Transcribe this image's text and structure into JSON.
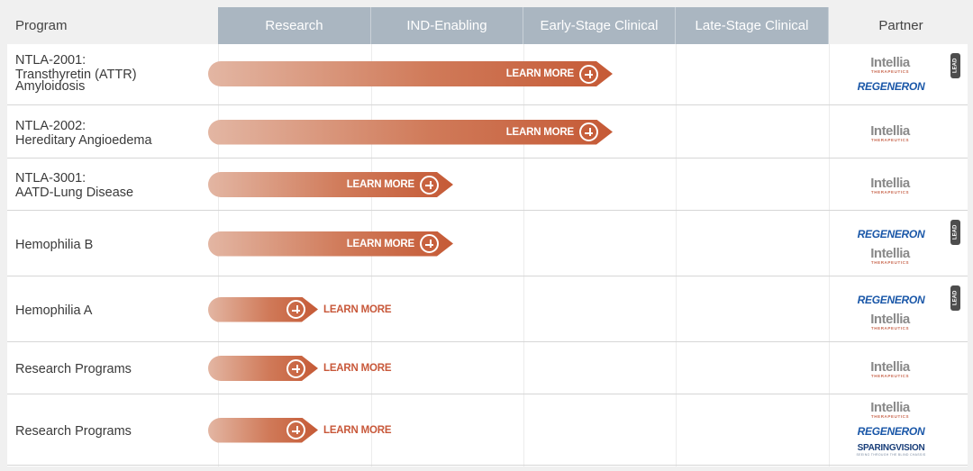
{
  "header": {
    "program": "Program",
    "phases": [
      "Research",
      "IND-Enabling",
      "Early-Stage Clinical",
      "Late-Stage Clinical"
    ],
    "partner": "Partner"
  },
  "bar_label": "LEARN MORE",
  "lead_badge": "LEAD",
  "logos": {
    "intellia": "Intellia",
    "intellia_sub": "THERAPEUTICS",
    "regeneron": "REGENERON",
    "sparingvision": "SPARINGVISION",
    "sparingvision_sub": "SEEING THROUGH THE BLIND CHASSIS"
  },
  "programs": [
    {
      "name": "NTLA-2001:\nTransthyretin (ATTR)\nAmyloidosis",
      "phase_progress": 2.6,
      "partners": [
        "intellia",
        "regeneron"
      ],
      "lead": true
    },
    {
      "name": "NTLA-2002:\nHereditary Angioedema",
      "phase_progress": 2.6,
      "partners": [
        "intellia"
      ],
      "lead": false
    },
    {
      "name": "NTLA-3001:\nAATD-Lung Disease",
      "phase_progress": 1.55,
      "partners": [
        "intellia"
      ],
      "lead": false
    },
    {
      "name": "Hemophilia B",
      "phase_progress": 1.55,
      "partners": [
        "regeneron",
        "intellia"
      ],
      "lead": true
    },
    {
      "name": "Hemophilia A",
      "phase_progress": 0.65,
      "partners": [
        "regeneron",
        "intellia"
      ],
      "lead": true
    },
    {
      "name": "Research Programs",
      "phase_progress": 0.65,
      "partners": [
        "intellia"
      ],
      "lead": false
    },
    {
      "name": "Research Programs",
      "phase_progress": 0.65,
      "partners": [
        "intellia",
        "regeneron",
        "sparingvision"
      ],
      "lead": false
    }
  ],
  "colors": {
    "header_bg": "#aab6c1",
    "bar_dark": "#c55a36",
    "bar_light": "#e3b6a3",
    "regeneron_blue": "#1a57a8"
  }
}
